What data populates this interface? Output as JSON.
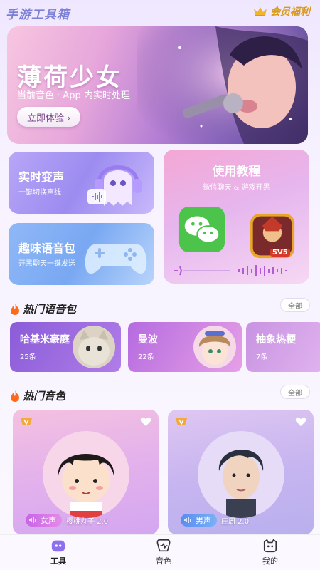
{
  "app": {
    "title": "手游工具箱",
    "vip_label": "会员福利"
  },
  "banner": {
    "title": "薄荷少女",
    "subtitle": "当前音色 · App 内实时处理",
    "cta": "立即体验 ›"
  },
  "features": {
    "realtime": {
      "title": "实时变声",
      "subtitle": "一键切换声线"
    },
    "pack": {
      "title": "趣味语音包",
      "subtitle": "开黑聊天一键发送"
    },
    "tutorial": {
      "title": "使用教程",
      "subtitle": "微信聊天 & 游戏开黑",
      "game_badge": "5V5"
    }
  },
  "hot_packs": {
    "title": "热门语音包",
    "all_label": "全部",
    "items": [
      {
        "name": "哈基米豪庭",
        "count": "25条"
      },
      {
        "name": "曼波",
        "count": "22条"
      },
      {
        "name": "抽象热梗",
        "count": "7条"
      }
    ]
  },
  "hot_voices": {
    "title": "热门音色",
    "all_label": "全部",
    "items": [
      {
        "gender": "女声",
        "name": "樱桃丸子 2.0"
      },
      {
        "gender": "男声",
        "name": "庄周 2.0"
      }
    ]
  },
  "tabs": [
    {
      "label": "工具",
      "active": true
    },
    {
      "label": "音色",
      "active": false
    },
    {
      "label": "我的",
      "active": false
    }
  ],
  "colors": {
    "accent": "#8d6ff0",
    "vip_gold": "#d99a1c",
    "female_tag": "#c865e6",
    "male_tag": "#5a8cf0"
  }
}
